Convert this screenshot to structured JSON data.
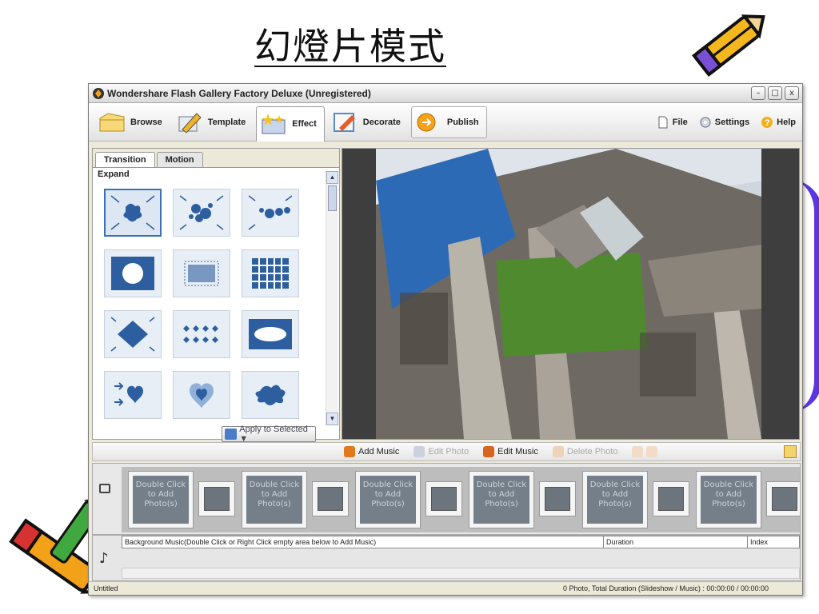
{
  "slide": {
    "title": "幻燈片模式"
  },
  "window": {
    "title": "Wondershare Flash Gallery Factory Deluxe (Unregistered)",
    "controls": {
      "minimize": "–",
      "maximize": "□",
      "close": "x"
    }
  },
  "toolbar": {
    "buttons": [
      {
        "label": "Browse"
      },
      {
        "label": "Template"
      },
      {
        "label": "Effect"
      },
      {
        "label": "Decorate"
      },
      {
        "label": "Publish"
      }
    ],
    "menus": [
      {
        "label": "File"
      },
      {
        "label": "Settings"
      },
      {
        "label": "Help"
      }
    ]
  },
  "effects_panel": {
    "tabs": [
      "Transition",
      "Motion"
    ],
    "active_tab": "Transition",
    "group_label": "Expand",
    "apply_label": "Apply to Selected ▼"
  },
  "mid_toolbar": {
    "add_music": "Add Music",
    "edit_photo": "Edit Photo",
    "edit_music": "Edit Music",
    "delete_photo": "Delete Photo"
  },
  "storyboard": {
    "slot_text": "Double Click\nto Add\nPhoto(s)",
    "slots": [
      "Double Click to Add Photo(s)",
      "Double Click to Add Photo(s)",
      "Double Click to Add Photo(s)",
      "Double Click to Add Photo(s)",
      "Double Click to Add Photo(s)",
      "Double Click to Add Photo(s)"
    ]
  },
  "music": {
    "col_background": "Background Music(Double Click or Right Click empty area below to Add Music)",
    "col_duration": "Duration",
    "col_index": "Index"
  },
  "status": {
    "left": "Untitled",
    "right": "0 Photo, Total Duration (Slideshow / Music) : 00:00:00 / 00:00:00"
  },
  "colors": {
    "accent": "#3c6fb8",
    "window_bg": "#ece9d8",
    "purple_decor": "#5b36e0"
  }
}
